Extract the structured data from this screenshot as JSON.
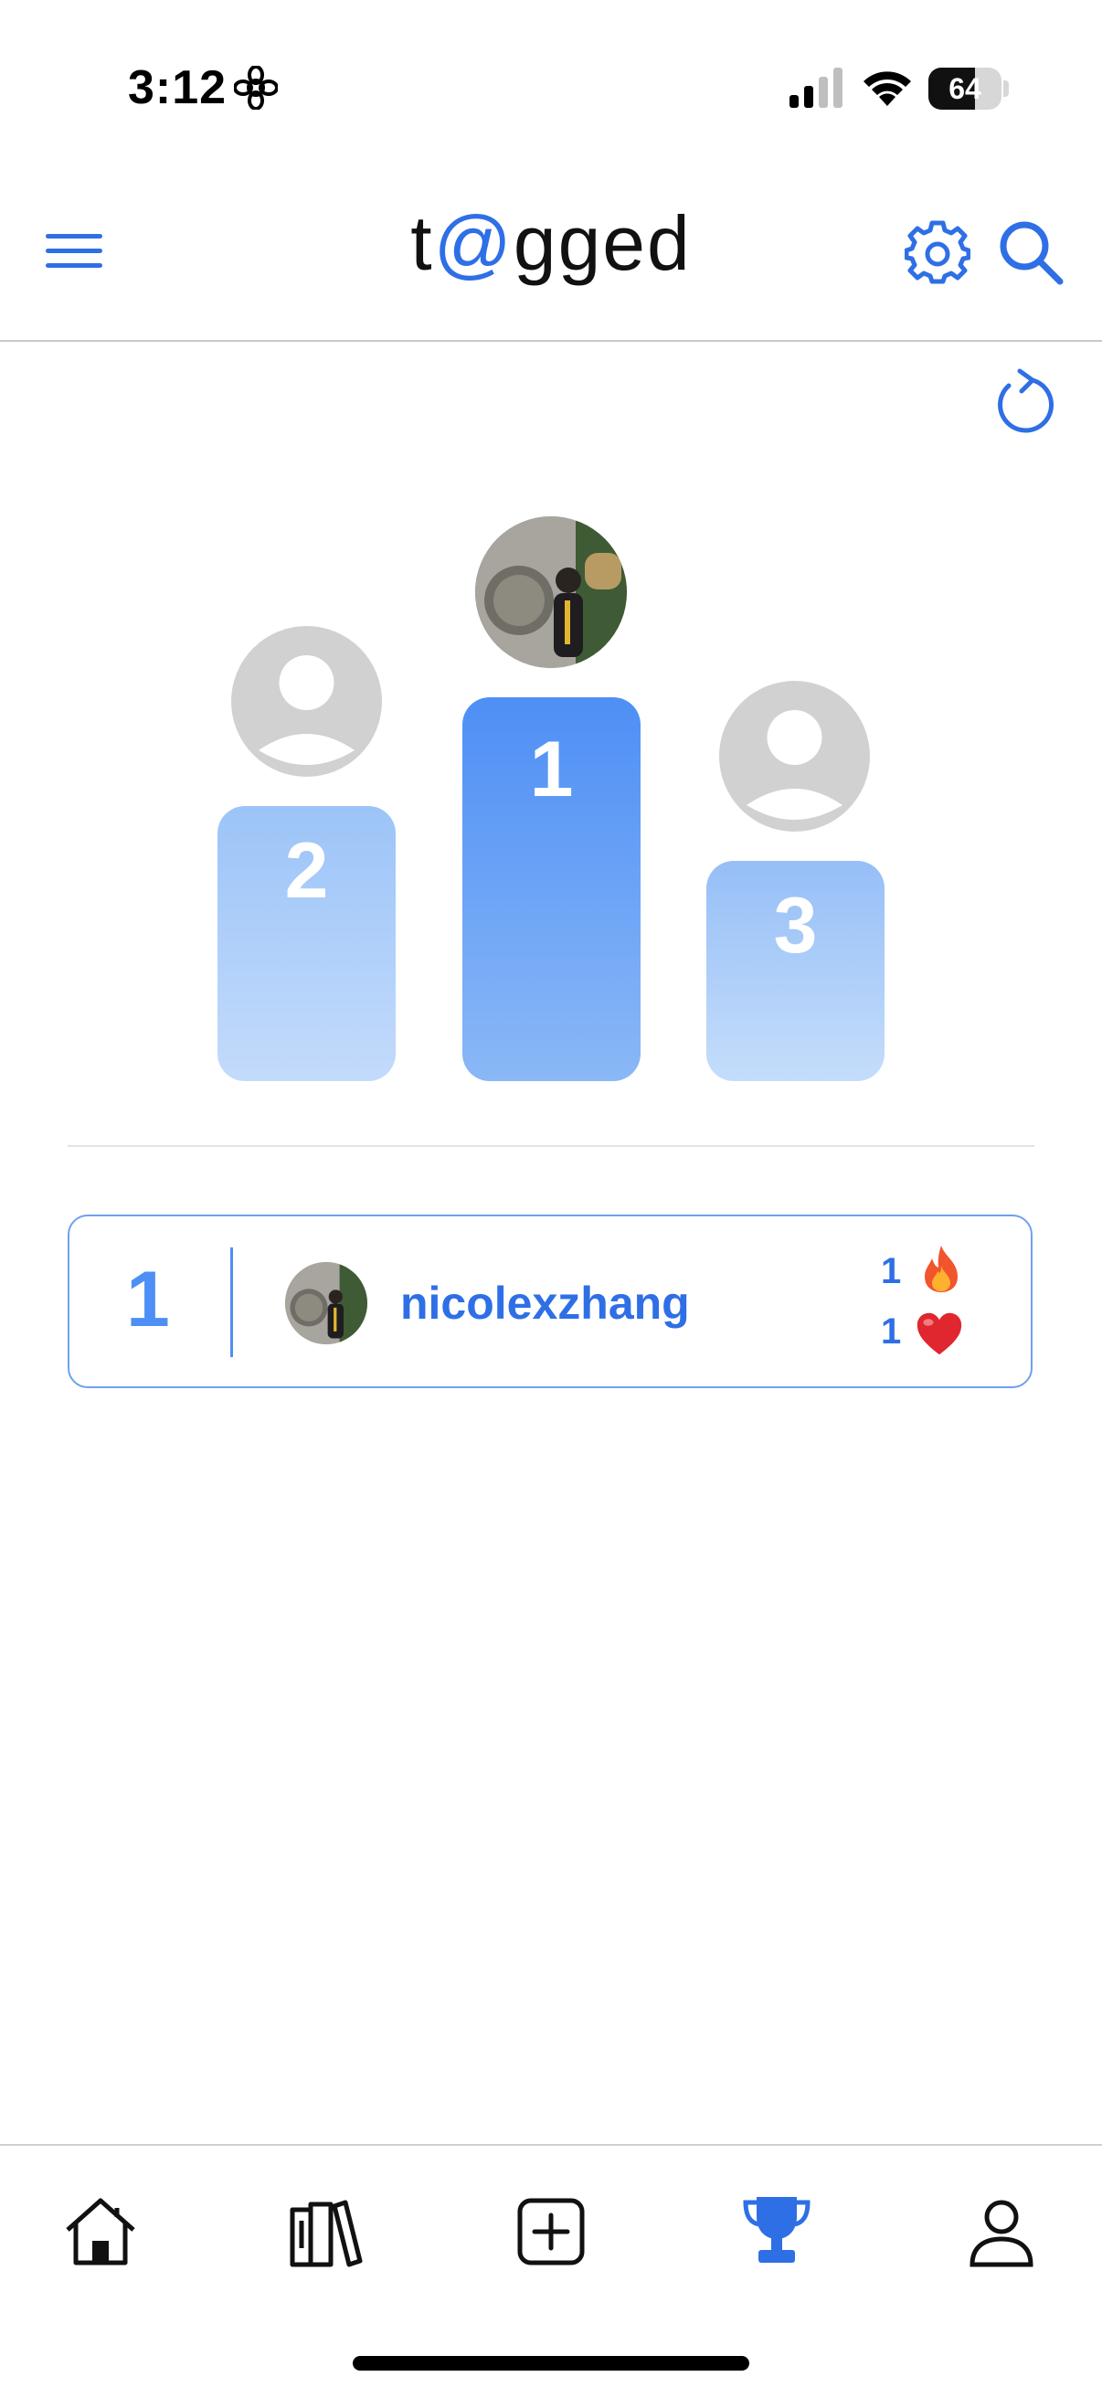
{
  "status_bar": {
    "time": "3:12",
    "battery": "64",
    "battery_level": 0.64
  },
  "header": {
    "logo_prefix": "t",
    "logo_at": "@",
    "logo_suffix": "gged"
  },
  "podium": [
    {
      "place": "1",
      "label": "1",
      "avatar": "photo"
    },
    {
      "place": "2",
      "label": "2",
      "avatar": "placeholder-person"
    },
    {
      "place": "3",
      "label": "3",
      "avatar": "placeholder-person"
    }
  ],
  "leaderboard": [
    {
      "rank": "1",
      "username": "nicolexzhang",
      "fire_count": "1",
      "fire_icon": "fire-emoji",
      "heart_count": "1",
      "heart_icon": "heart-emoji"
    }
  ],
  "tabbar": {
    "items": [
      {
        "name": "home",
        "icon": "house-icon"
      },
      {
        "name": "library",
        "icon": "books-icon"
      },
      {
        "name": "create",
        "icon": "plus-square-icon"
      },
      {
        "name": "leaderboard",
        "icon": "trophy-icon",
        "active": true
      },
      {
        "name": "profile",
        "icon": "person-icon"
      }
    ]
  },
  "colors": {
    "accent": "#2f6fe6",
    "podium_primary": "#4e8ff5",
    "podium_light": "#b9d5fa",
    "placeholder": "#d1d1d1"
  }
}
